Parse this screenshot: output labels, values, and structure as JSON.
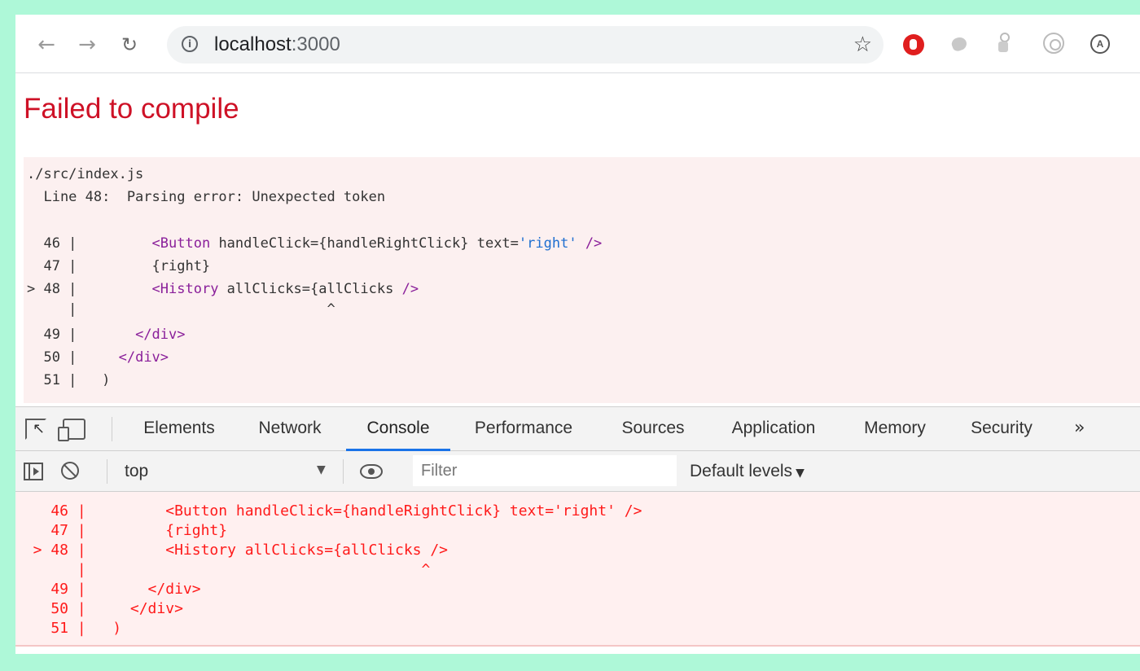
{
  "browser": {
    "url_host": "localhost",
    "url_port": ":3000",
    "icons": {
      "back": "arrow-left-icon",
      "forward": "arrow-right-icon",
      "reload": "reload-icon",
      "info": "info-icon",
      "bookmark": "star-icon"
    },
    "extensions": [
      "stop-extension-icon",
      "blob-extension-icon",
      "figure-extension-icon",
      "target-extension-icon",
      "a-extension-icon"
    ]
  },
  "overlay": {
    "title": "Failed to compile",
    "file": "./src/index.js",
    "message": "  Line 48:  Parsing error: Unexpected token",
    "code": {
      "l46_num": "  46 | ",
      "l46_tag": "<Button",
      "l46_mid": " handleClick={handleRightClick} text=",
      "l46_str": "'right'",
      "l46_end": "/>",
      "l47": "  47 |         {right}",
      "l48_num": "> 48 | ",
      "l48_tag": "<History",
      "l48_mid": " allClicks={allClicks ",
      "l48_end": "/>",
      "caret": "     |                              ^",
      "l49_num": "  49 | ",
      "l49_tag": "</div>",
      "l50_num": "  50 | ",
      "l50_tag": "</div>",
      "l51": "  51 |   )"
    }
  },
  "devtools": {
    "tabs": [
      "Elements",
      "Network",
      "Console",
      "Performance",
      "Sources",
      "Application",
      "Memory",
      "Security"
    ],
    "active_tab": "Console",
    "more": "»",
    "context": "top",
    "context_arrow": "▼",
    "filter_placeholder": "Filter",
    "levels": "Default levels",
    "levels_arrow": "▼",
    "console_lines": [
      "    46 |         <Button handleClick={handleRightClick} text='right' />",
      "    47 |         {right}",
      "  > 48 |         <History allClicks={allClicks />",
      "       |                                      ^",
      "    49 |       </div>",
      "    50 |     </div>",
      "    51 |   )"
    ]
  }
}
